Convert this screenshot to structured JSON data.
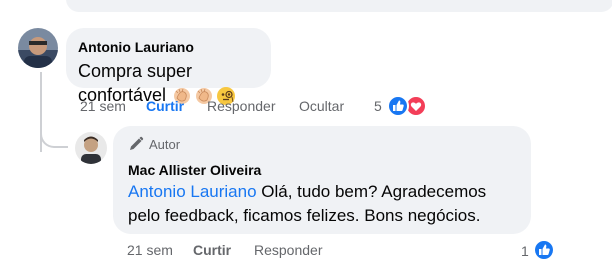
{
  "comment": {
    "author": "Antonio Lauriano",
    "text": "Compra super confortável",
    "emojis": [
      "clapping-hands-icon",
      "clapping-hands-icon",
      "monocle-face-icon"
    ],
    "time": "21 sem",
    "like_label": "Curtir",
    "reply_label": "Responder",
    "hide_label": "Ocultar",
    "reaction_count": "5"
  },
  "reply": {
    "badge": "Autor",
    "author": "Mac Allister Oliveira",
    "mention": "Antonio Lauriano",
    "text": " Olá, tudo bem? Agradecemos pelo feedback, ficamos felizes. Bons negócios.",
    "time": "21 sem",
    "like_label": "Curtir",
    "reply_label": "Responder",
    "reaction_count": "1"
  },
  "colors": {
    "accent": "#1877f2",
    "bubble": "#f0f2f5",
    "muted": "#65676b",
    "love": "#f33e58"
  }
}
